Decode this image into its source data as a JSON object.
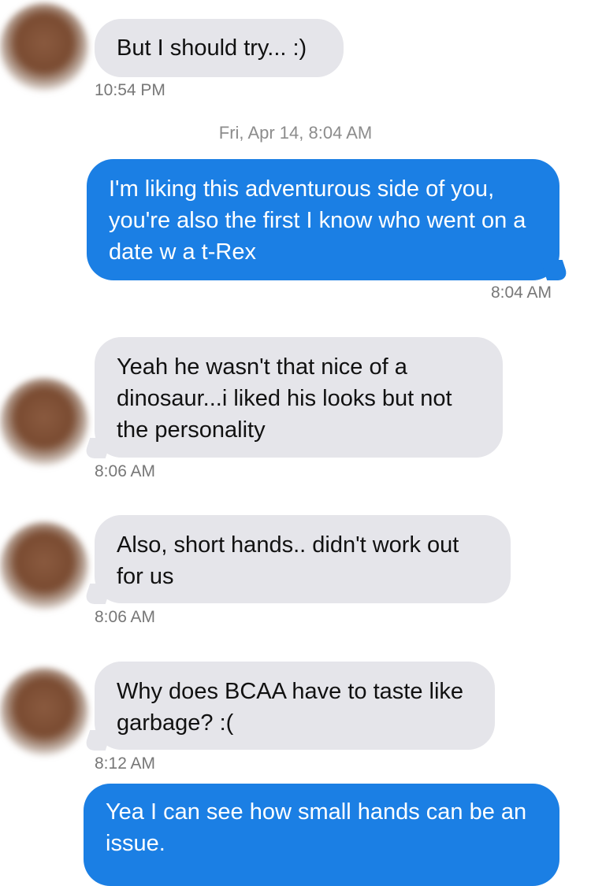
{
  "messages": [
    {
      "id": "m1",
      "side": "incoming",
      "text": "But I should try... :)",
      "time": "10:54 PM"
    },
    {
      "id": "m2",
      "side": "outgoing",
      "text": "I'm liking this adventurous side of you, you're also the first I know who went on a date w a t-Rex",
      "time": "8:04 AM"
    },
    {
      "id": "m3",
      "side": "incoming",
      "text": "Yeah he wasn't that nice of a dinosaur...i liked his looks but not the personality",
      "time": "8:06 AM"
    },
    {
      "id": "m4",
      "side": "incoming",
      "text": "Also, short hands.. didn't work out for us",
      "time": "8:06 AM"
    },
    {
      "id": "m5",
      "side": "incoming",
      "text": "Why does BCAA have to taste like garbage? :(",
      "time": "8:12 AM"
    },
    {
      "id": "m6",
      "side": "outgoing",
      "text": "Yea I can see how small hands can be an issue.",
      "time": ""
    }
  ],
  "day_separator": "Fri, Apr 14, 8:04 AM",
  "colors": {
    "incoming_bubble": "#e5e5ea",
    "outgoing_bubble": "#1b7fe4",
    "timestamp": "#777777"
  }
}
